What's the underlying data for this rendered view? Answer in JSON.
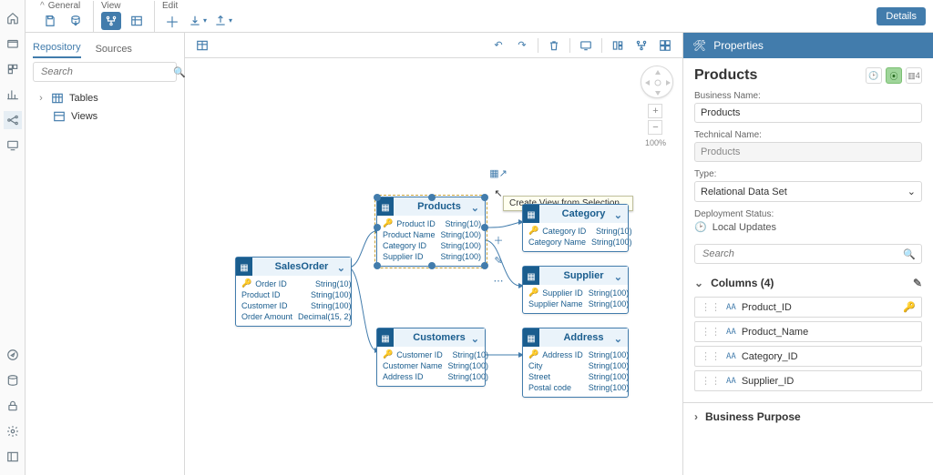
{
  "ribbon": {
    "groups": [
      {
        "label": "General"
      },
      {
        "label": "View"
      },
      {
        "label": "Edit"
      }
    ]
  },
  "details_button": "Details",
  "repo": {
    "tabs": {
      "repository": "Repository",
      "sources": "Sources"
    },
    "search_placeholder": "Search",
    "tree": {
      "tables": "Tables",
      "views": "Views"
    }
  },
  "canvas": {
    "zoom": "100%",
    "tooltip": "Create View from Selection...",
    "nodes": {
      "salesorder": {
        "title": "SalesOrder",
        "cols": [
          {
            "name": "Order ID",
            "type": "String(10)",
            "key": true
          },
          {
            "name": "Product ID",
            "type": "String(100)"
          },
          {
            "name": "Customer ID",
            "type": "String(100)"
          },
          {
            "name": "Order Amount",
            "type": "Decimal(15, 2)"
          }
        ]
      },
      "products": {
        "title": "Products",
        "cols": [
          {
            "name": "Product ID",
            "type": "String(10)",
            "key": true
          },
          {
            "name": "Product Name",
            "type": "String(100)"
          },
          {
            "name": "Category ID",
            "type": "String(100)"
          },
          {
            "name": "Supplier ID",
            "type": "String(100)"
          }
        ]
      },
      "category": {
        "title": "Category",
        "cols": [
          {
            "name": "Category ID",
            "type": "String(10)",
            "key": true
          },
          {
            "name": "Category Name",
            "type": "String(100)"
          }
        ]
      },
      "supplier": {
        "title": "Supplier",
        "cols": [
          {
            "name": "Supplier ID",
            "type": "String(100)",
            "key": true
          },
          {
            "name": "Supplier Name",
            "type": "String(100)"
          }
        ]
      },
      "customers": {
        "title": "Customers",
        "cols": [
          {
            "name": "Customer ID",
            "type": "String(10)",
            "key": true
          },
          {
            "name": "Customer Name",
            "type": "String(100)"
          },
          {
            "name": "Address ID",
            "type": "String(100)"
          }
        ]
      },
      "address": {
        "title": "Address",
        "cols": [
          {
            "name": "Address ID",
            "type": "String(100)",
            "key": true
          },
          {
            "name": "City",
            "type": "String(100)"
          },
          {
            "name": "Street",
            "type": "String(100)"
          },
          {
            "name": "Postal code",
            "type": "String(100)"
          }
        ]
      }
    }
  },
  "props": {
    "panel_title": "Properties",
    "entity_title": "Products",
    "col_badge": "4",
    "business_name": {
      "label": "Business Name:",
      "value": "Products"
    },
    "technical_name": {
      "label": "Technical Name:",
      "value": "Products"
    },
    "type": {
      "label": "Type:",
      "value": "Relational Data Set"
    },
    "deployment": {
      "label": "Deployment Status:",
      "value": "Local Updates"
    },
    "search_placeholder": "Search",
    "columns_section": "Columns (4)",
    "columns": [
      {
        "name": "Product_ID",
        "key": true
      },
      {
        "name": "Product_Name"
      },
      {
        "name": "Category_ID"
      },
      {
        "name": "Supplier_ID"
      }
    ],
    "business_purpose": "Business Purpose"
  }
}
